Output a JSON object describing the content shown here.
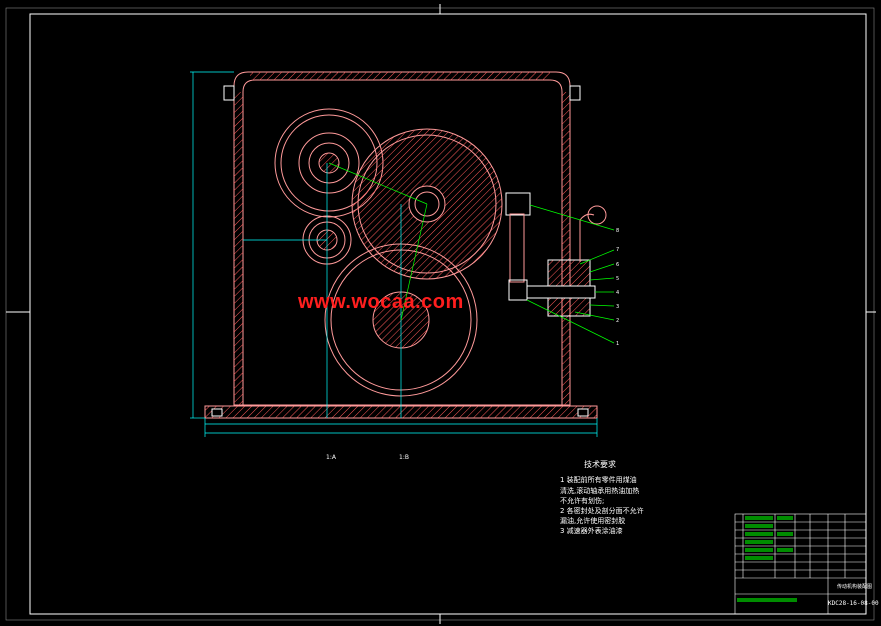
{
  "watermark": "www.wocaa.com",
  "technical_requirements": {
    "title": "技术要求",
    "lines": [
      "1 装配前所有零件用煤油",
      "  清洗,滚动轴承用热油加热",
      "  不允许有划伤;",
      "2 各密封处及剖分面不允许",
      "  漏油,允许使用密封胶",
      "3 减速器外表涂油漆"
    ]
  },
  "section_labels": [
    "1:A",
    "1:B"
  ],
  "part_numbers": [
    "8",
    "7",
    "6",
    "5",
    "4",
    "3",
    "2",
    "1"
  ],
  "title_block": {
    "drawing_code": "KDC28-16-08-00",
    "name": "传动机构装配图"
  },
  "colors": {
    "background": "#000000",
    "frame": "#ffffff",
    "outline": "#ff9a9a",
    "hatch": "#ff5a5a",
    "dimension": "#00ffff",
    "centerline": "#00ff00",
    "watermark": "#ff1e1e"
  }
}
